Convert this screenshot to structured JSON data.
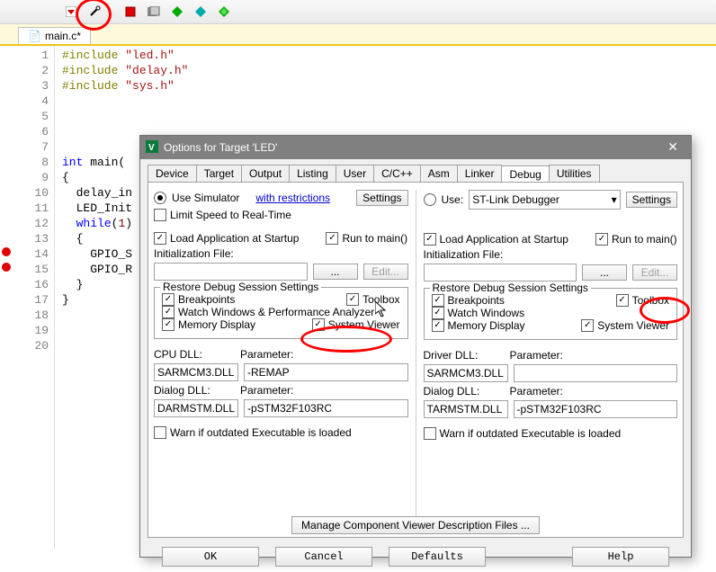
{
  "filetab": "main.c*",
  "code": {
    "1": "#include \"led.h\"",
    "2": "#include \"delay.h\"",
    "3": "#include \"sys.h\"",
    "8": "int main(",
    "9": "{",
    "10": "  delay_in",
    "11": "  LED_Init",
    "12": "  while(1)",
    "13": "  {",
    "14": "    GPIO_S",
    "15": "    GPIO_R",
    "16": "  }",
    "17": "}"
  },
  "dialog": {
    "title": "Options for Target 'LED'",
    "tabs": [
      "Device",
      "Target",
      "Output",
      "Listing",
      "User",
      "C/C++",
      "Asm",
      "Linker",
      "Debug",
      "Utilities"
    ],
    "active_tab": "Debug",
    "left": {
      "use_simulator": "Use Simulator",
      "with_restrictions": "with restrictions",
      "settings_btn": "Settings",
      "limit_speed": "Limit Speed to Real-Time",
      "load_app": "Load Application at Startup",
      "run_to_main": "Run to main()",
      "init_file_label": "Initialization File:",
      "init_file_value": "",
      "edit_btn": "Edit...",
      "restore_legend": "Restore Debug Session Settings",
      "breakpoints": "Breakpoints",
      "toolbox": "Toolbox",
      "watch_perf": "Watch Windows & Performance Analyzer",
      "memory_display": "Memory Display",
      "system_viewer": "System Viewer",
      "cpu_dll_label": "CPU DLL:",
      "cpu_dll_value": "SARMCM3.DLL",
      "cpu_param_label": "Parameter:",
      "cpu_param_value": "-REMAP",
      "dialog_dll_label": "Dialog DLL:",
      "dialog_dll_value": "DARMSTM.DLL",
      "dialog_param_label": "Parameter:",
      "dialog_param_value": "-pSTM32F103RC",
      "warn_outdated": "Warn if outdated Executable is loaded"
    },
    "right": {
      "use_label": "Use:",
      "debugger": "ST-Link Debugger",
      "settings_btn": "Settings",
      "load_app": "Load Application at Startup",
      "run_to_main": "Run to main()",
      "init_file_label": "Initialization File:",
      "init_file_value": "",
      "edit_btn": "Edit...",
      "restore_legend": "Restore Debug Session Settings",
      "breakpoints": "Breakpoints",
      "toolbox": "Toolbox",
      "watch_windows": "Watch Windows",
      "memory_display": "Memory Display",
      "system_viewer": "System Viewer",
      "driver_dll_label": "Driver DLL:",
      "driver_dll_value": "SARMCM3.DLL",
      "driver_param_label": "Parameter:",
      "driver_param_value": "",
      "dialog_dll_label": "Dialog DLL:",
      "dialog_dll_value": "TARMSTM.DLL",
      "dialog_param_label": "Parameter:",
      "dialog_param_value": "-pSTM32F103RC",
      "warn_outdated": "Warn if outdated Executable is loaded"
    },
    "manage_btn": "Manage Component Viewer Description Files ...",
    "ok": "OK",
    "cancel": "Cancel",
    "defaults": "Defaults",
    "help": "Help"
  }
}
